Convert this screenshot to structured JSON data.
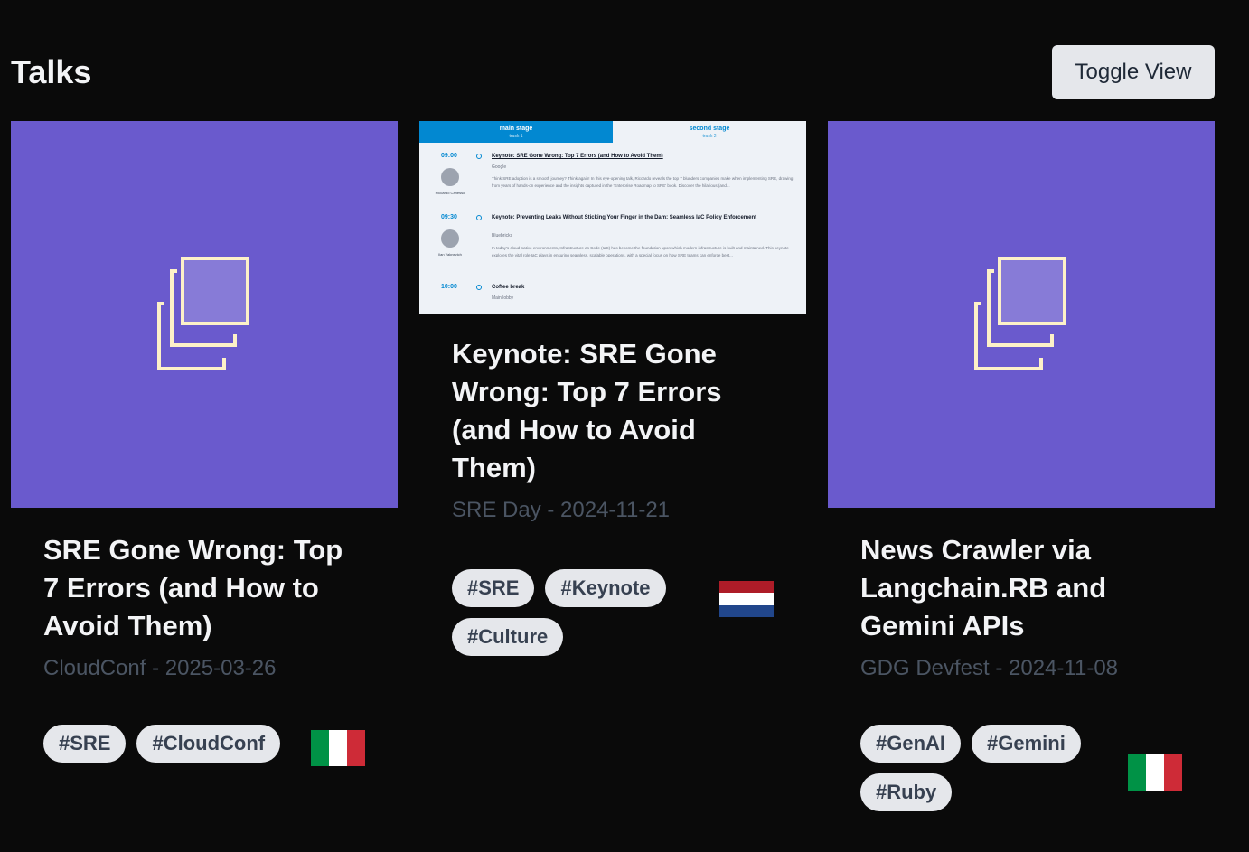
{
  "header": {
    "title": "Talks",
    "toggle_label": "Toggle View"
  },
  "cards": [
    {
      "image": "placeholder-icon",
      "title": "SRE Gone Wrong: Top 7 Errors (and How to Avoid Them)",
      "meta": "CloudConf - 2025-03-26",
      "tags": [
        "#SRE",
        "#CloudConf"
      ],
      "flag": "italy-flag"
    },
    {
      "image": "schedule-screenshot",
      "title": "Keynote: SRE Gone Wrong: Top 7 Errors (and How to Avoid Them)",
      "meta": "SRE Day - 2024-11-21",
      "tags": [
        "#SRE",
        "#Keynote",
        "#Culture"
      ],
      "flag": "netherlands-flag",
      "thumbnail": {
        "tab_main": "main stage",
        "tab_main_sub": "track 1",
        "tab_second": "second stage",
        "tab_second_sub": "track 2",
        "items": [
          {
            "time": "09:00",
            "title": "Keynote: SRE Gone Wrong: Top 7 Errors (and How to Avoid Them)",
            "org": "Google",
            "speaker": "Riccardo Carlesso",
            "desc": "Think SRE adoption is a smooth journey? Think again! In this eye-opening talk, Riccardo reveals the top 7 blunders companies make when implementing SRE, drawing from years of hands-on experience and the insights captured in the 'Enterprise Roadmap to SRE' book. Discover the hilarious (and..."
          },
          {
            "time": "09:30",
            "title": "Keynote: Preventing Leaks Without Sticking Your Finger in the Dam: Seamless IaC Policy Enforcement",
            "org": "Bluebricks",
            "speaker": "Ilan Yaknevich",
            "desc": "In today's cloud-native environments, Infrastructure as Code (IaC) has become the foundation upon which modern infrastructure is built and maintained. This keynote explores the vital role IaC plays in ensuring seamless, scalable operations, with a special focus on how SRE teams can enforce best..."
          },
          {
            "time": "10:00",
            "title": "Coffee break",
            "org": "Main lobby"
          }
        ]
      }
    },
    {
      "image": "placeholder-icon",
      "title": "News Crawler via Langchain.RB and Gemini APIs",
      "meta": "GDG Devfest - 2024-11-08",
      "tags": [
        "#GenAI",
        "#Gemini",
        "#Ruby"
      ],
      "flag": "italy-flag"
    }
  ],
  "colors": {
    "background": "#0a0a0a",
    "placeholder": "#6a5acd",
    "icon_stroke": "#fdf1c8",
    "tag_bg": "#e5e7eb",
    "italy": [
      "#009246",
      "#ffffff",
      "#ce2b37"
    ],
    "netherlands": [
      "#ae1c28",
      "#ffffff",
      "#21468b"
    ]
  }
}
